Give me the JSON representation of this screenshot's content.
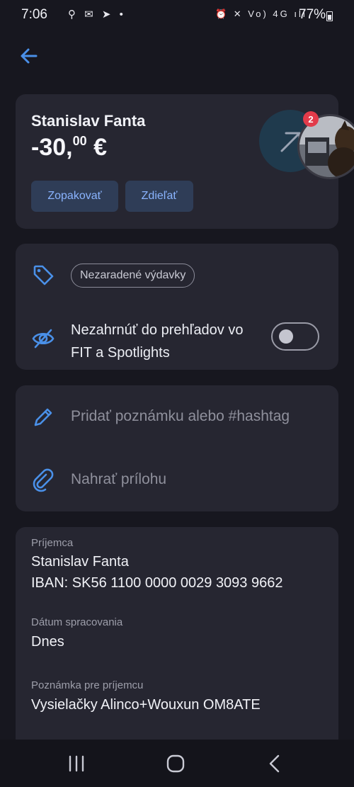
{
  "status_bar": {
    "time": "7:06",
    "left_icons": "⚲ ✉ ➤ •",
    "right_icons": "⏰ ✕ Vo) 4G ıll",
    "battery": "77%"
  },
  "header": {
    "back_icon": "arrow-left-icon"
  },
  "transaction": {
    "recipient": "Stanislav Fanta",
    "amount_main": "-30,",
    "amount_cents": "00",
    "amount_currency": " €",
    "badge_count": "2",
    "repeat_label": "Zopakovať",
    "share_label": "Zdieľať"
  },
  "category": {
    "chip_label": "Nezaradené výdavky",
    "exclude_label": "Nezahrnúť do prehľadov vo FIT a Spotlights",
    "exclude_enabled": false
  },
  "actions": {
    "note_label": "Pridať poznámku alebo #hashtag",
    "attachment_label": "Nahrať prílohu"
  },
  "details": {
    "recipient_label": "Príjemca",
    "recipient_name": "Stanislav Fanta",
    "recipient_iban": "IBAN: SK56 1100 0000 0029 3093 9662",
    "date_label": "Dátum spracovania",
    "date_value": "Dnes",
    "note_label": "Poznámka pre príjemcu",
    "note_value": "Vysielačky Alinco+Wouxun OM8ATE"
  },
  "colors": {
    "background": "#17171f",
    "card": "#262631",
    "accent": "#4a90e8",
    "button_bg": "#2f3d57"
  }
}
